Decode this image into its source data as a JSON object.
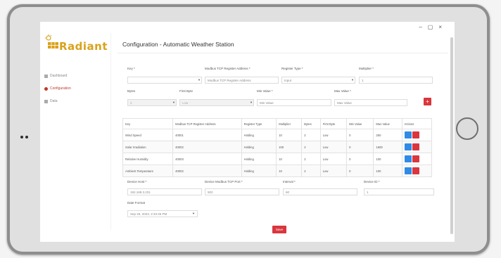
{
  "window_controls": [
    "–",
    "▢",
    "×"
  ],
  "brand": {
    "name": "Radiant",
    "color": "#d9a21b"
  },
  "sidebar": {
    "items": [
      {
        "label": "Dashboard",
        "active": false
      },
      {
        "label": "Configuration",
        "active": true
      },
      {
        "label": "Data",
        "active": false
      }
    ]
  },
  "page_title": "Configuration - Automatic Weather Station",
  "form": {
    "key_label": "Key *",
    "key_value": "",
    "register_address_label": "Modbus TCP Register Address *",
    "register_address_placeholder": "Modbus TCP Register Address",
    "register_type_label": "Register Type *",
    "register_type_value": "Input",
    "multiplier_label": "Multiplier *",
    "multiplier_value": "1",
    "bytes_label": "Bytes",
    "bytes_value": "2",
    "first_byte_label": "First Byte",
    "first_byte_value": "Low",
    "min_value_label": "Min Value *",
    "min_value_placeholder": "Min Value",
    "max_value_label": "Max Value *",
    "max_value_placeholder": "Max Value",
    "add_label": "+"
  },
  "table": {
    "headers": [
      "Key",
      "Modbus TCP Register Address",
      "Register Type",
      "Multiplier",
      "Bytes",
      "First Byte",
      "Min Value",
      "Max Value",
      "Actions"
    ],
    "rows": [
      [
        "Wind Speed",
        "40001",
        "Holding",
        "10",
        "2",
        "Low",
        "0",
        "250"
      ],
      [
        "Solar Irradiation",
        "40002",
        "Holding",
        "100",
        "2",
        "Low",
        "0",
        "1600"
      ],
      [
        "Relative Humidity",
        "40003",
        "Holding",
        "10",
        "2",
        "Low",
        "0",
        "100"
      ],
      [
        "Ambient Temperature",
        "40002",
        "Holding",
        "10",
        "2",
        "Low",
        "0",
        "100"
      ]
    ]
  },
  "device": {
    "host_label": "Device Host *",
    "host_value": "192.168.3.231",
    "port_label": "Device Modbus TCP Port *",
    "port_value": "502",
    "interval_label": "Interval *",
    "interval_value": "60",
    "device_id_label": "Device ID *",
    "device_id_value": "1",
    "date_format_label": "Date Format",
    "date_format_value": "Sep 25, 2023, 2:33:45 PM"
  },
  "save_label": "Save",
  "colors": {
    "danger": "#d9363e",
    "primary": "#2f8be6"
  }
}
